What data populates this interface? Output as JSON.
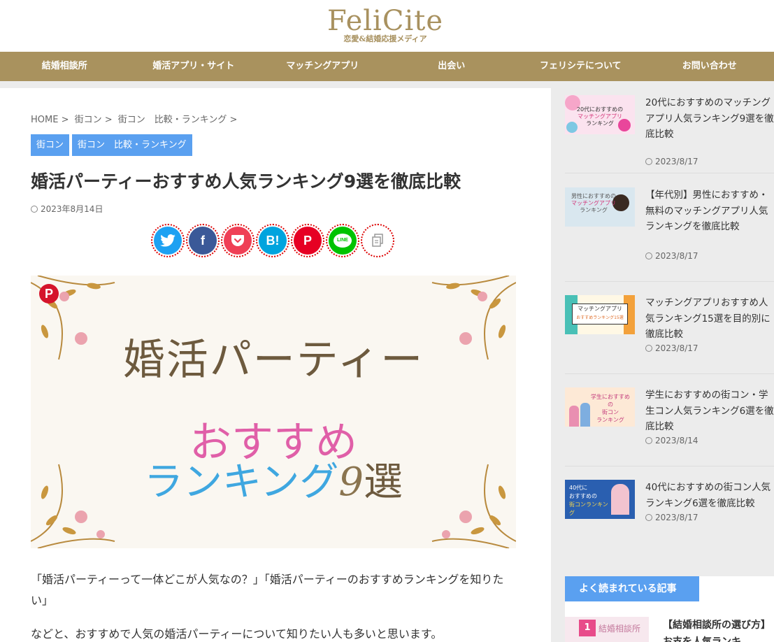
{
  "header": {
    "logo_main": "FeliCite",
    "logo_sub": "恋愛&結婚応援メディア"
  },
  "nav": [
    {
      "label": "結婚相談所"
    },
    {
      "label": "婚活アプリ・サイト"
    },
    {
      "label": "マッチングアプリ"
    },
    {
      "label": "出会い"
    },
    {
      "label": "フェリシテについて"
    },
    {
      "label": "お問い合わせ"
    }
  ],
  "breadcrumb": [
    {
      "label": "HOME >"
    },
    {
      "label": "街コン >"
    },
    {
      "label": "街コン　比較・ランキング >"
    }
  ],
  "categories": [
    {
      "label": "街コン"
    },
    {
      "label": "街コン　比較・ランキング"
    }
  ],
  "article": {
    "title": "婚活パーティーおすすめ人気ランキング9選を徹底比較",
    "date": "2023年8月14日",
    "hero": {
      "line1": "婚活パーティー",
      "line2": "おすすめ",
      "line3": "ランキング",
      "number": "9",
      "suffix": "選"
    },
    "paragraphs": [
      "「婚活パーティーって一体どこが人気なの？」「婚活パーティーのおすすめランキングを知りたい」",
      "などと、おすすめで人気の婚活パーティーについて知りたい人も多いと思います。"
    ]
  },
  "share": [
    {
      "name": "twitter",
      "glyph": "",
      "color": "#1da1f2"
    },
    {
      "name": "facebook",
      "glyph": "f",
      "color": "#3b5998"
    },
    {
      "name": "pocket",
      "glyph": "",
      "color": "#ef4056"
    },
    {
      "name": "hatena",
      "glyph": "B!",
      "color": "#00a4de"
    },
    {
      "name": "pinterest",
      "glyph": "P",
      "color": "#e60023"
    },
    {
      "name": "line",
      "glyph": "LINE",
      "color": "#00c300"
    },
    {
      "name": "copy",
      "glyph": "",
      "color": "#ffffff"
    }
  ],
  "sidebar": {
    "items": [
      {
        "title": "20代におすすめのマッチングアプリ人気ランキング9選を徹底比較",
        "date": "2023/8/17",
        "thumb_text1": "20代におすすめの",
        "thumb_text2": "マッチングアプリ",
        "thumb_text3": "ランキング"
      },
      {
        "title": "【年代別】男性におすすめ・無料のマッチングアプリ人気ランキングを徹底比較",
        "date": "2023/8/17",
        "thumb_text1": "男性におすすめの",
        "thumb_text2": "マッチングアプリ",
        "thumb_text3": "ランキング"
      },
      {
        "title": "マッチングアプリおすすめ人気ランキング15選を目的別に徹底比較",
        "date": "2023/8/17",
        "thumb_text1": "マッチングアプリ",
        "thumb_text2": "おすすめランキング15選"
      },
      {
        "title": "学生におすすめの街コン・学生コン人気ランキング6選を徹底比較",
        "date": "2023/8/14",
        "thumb_text1": "学生におすすめの",
        "thumb_text2": "街コン",
        "thumb_text3": "ランキング"
      },
      {
        "title": "40代におすすめの街コン人気ランキング6選を徹底比較",
        "date": "2023/8/17",
        "thumb_text1": "40代に",
        "thumb_text2": "おすすめの",
        "thumb_text3": "街コンランキング"
      }
    ],
    "widget_title": "よく読まれている記事",
    "popular": [
      {
        "rank": "1",
        "thumb_text": "結婚相談所",
        "title": "【結婚相談所の選び方】お支を人気ランキ"
      }
    ]
  }
}
